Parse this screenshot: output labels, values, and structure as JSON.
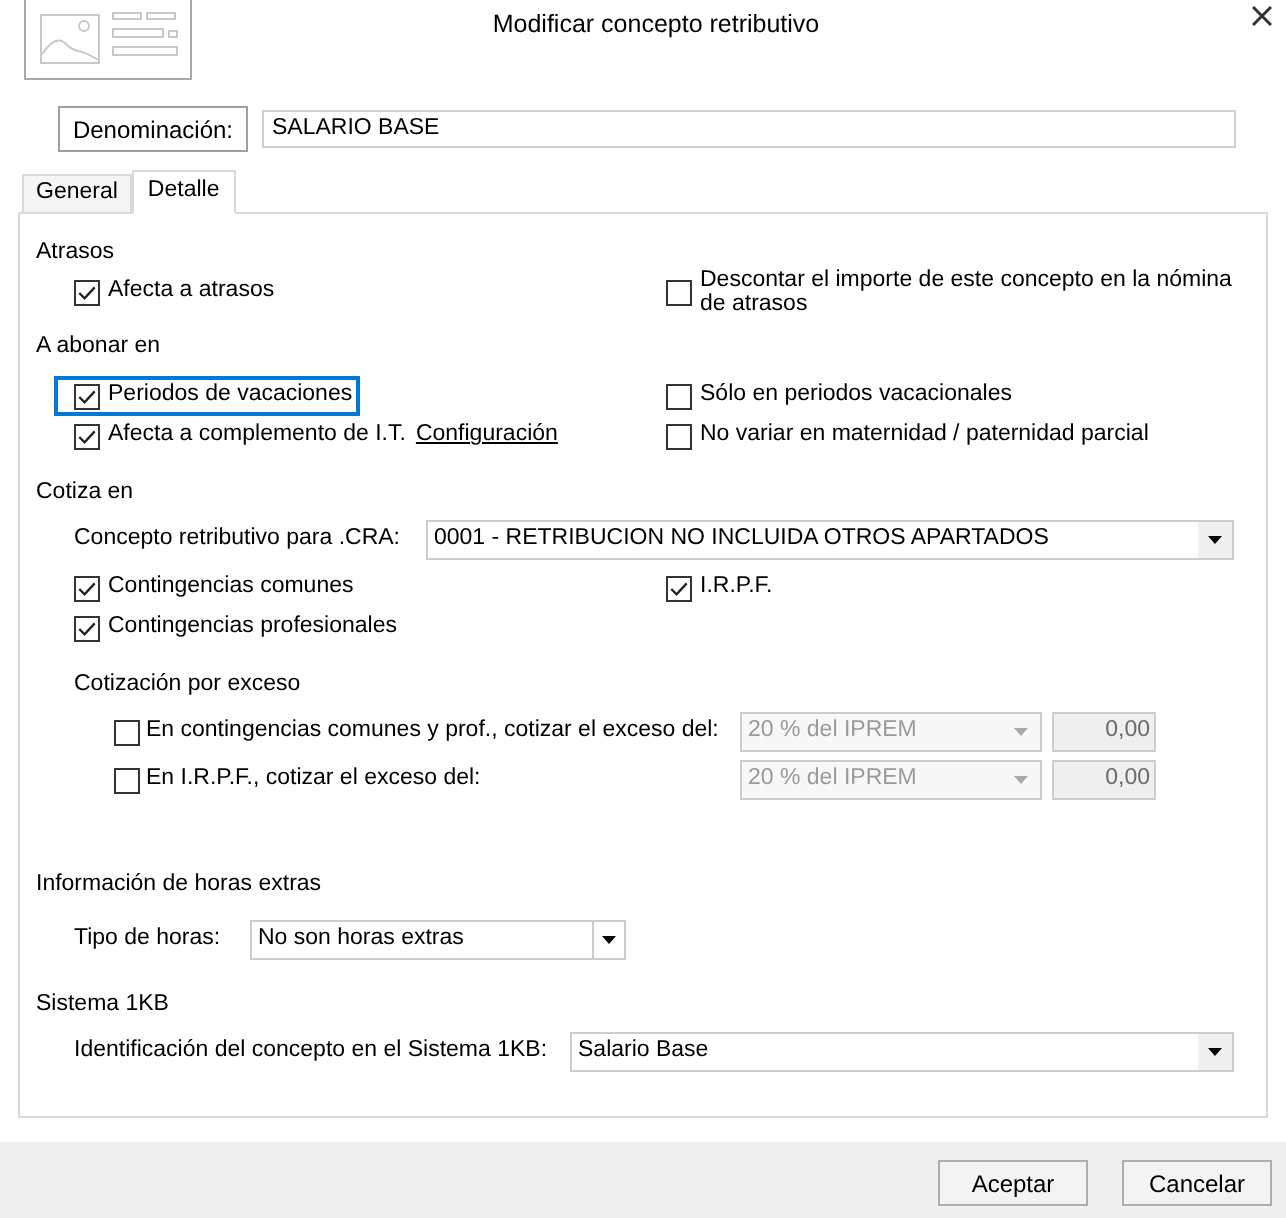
{
  "window": {
    "title": "Modificar concepto retributivo"
  },
  "name_field": {
    "label": "Denominación:",
    "value": "SALARIO BASE"
  },
  "tabs": [
    {
      "label": "General",
      "selected": false
    },
    {
      "label": "Detalle",
      "selected": true
    }
  ],
  "atrasos": {
    "title": "Atrasos",
    "options": [
      {
        "label": "Afecta a atrasos",
        "checked": true
      },
      {
        "label": "Descontar el importe de este concepto en la nómina de atrasos",
        "checked": false
      }
    ]
  },
  "a_abonar_en": {
    "title": "A abonar en",
    "options": [
      {
        "label": "Periodos de vacaciones",
        "checked": true,
        "focused": true
      },
      {
        "label": "Sólo en periodos vacacionales",
        "checked": false,
        "focused": false
      },
      {
        "label": "Afecta a complemento de I.T.",
        "checked": true,
        "focused": false,
        "link": "Configuración"
      },
      {
        "label": "No variar en maternidad / paternidad parcial",
        "checked": false,
        "focused": false
      }
    ]
  },
  "cotiza_en": {
    "title": "Cotiza en",
    "cra_field": {
      "label": "Concepto retributivo para .CRA:",
      "value": "0001 - RETRIBUCION NO INCLUIDA OTROS APARTADOS"
    },
    "options": [
      {
        "label": "Contingencias comunes",
        "checked": true
      },
      {
        "label": "I.R.P.F.",
        "checked": true
      },
      {
        "label": "Contingencias profesionales",
        "checked": true
      }
    ],
    "exceso": {
      "title": "Cotización por exceso",
      "rows": [
        {
          "label": "En contingencias comunes y prof., cotizar el exceso del:",
          "checked": false,
          "base": "20 % del IPREM",
          "amount": "0,00",
          "disabled": true
        },
        {
          "label": "En I.R.P.F., cotizar el exceso del:",
          "checked": false,
          "base": "20 % del IPREM",
          "amount": "0,00",
          "disabled": true
        }
      ]
    }
  },
  "horas_extras": {
    "title": "Información de horas extras",
    "field": {
      "label": "Tipo de horas:",
      "value": "No son horas extras"
    }
  },
  "sistema_1kb": {
    "title": "Sistema 1KB",
    "field": {
      "label": "Identificación del concepto en el Sistema 1KB:",
      "value": "Salario Base"
    }
  },
  "buttons": [
    "Aceptar",
    "Cancelar"
  ]
}
